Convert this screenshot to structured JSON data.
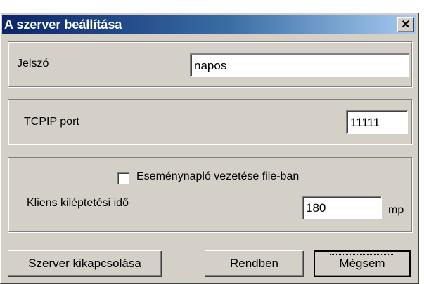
{
  "window": {
    "title": "A szerver beállítása",
    "close_label": "✕"
  },
  "password": {
    "label": "Jelszó",
    "value": "napos"
  },
  "port": {
    "label": "TCPIP port",
    "value": "11111"
  },
  "logging": {
    "checkbox_label": "Eseménynapló vezetése file-ban",
    "checked": false,
    "timeout_label": "Kliens kiléptetési idő",
    "timeout_value": "180",
    "timeout_unit": "mp"
  },
  "buttons": {
    "shutdown": "Szerver kikapcsolása",
    "ok": "Rendben",
    "cancel": "Mégsem"
  }
}
